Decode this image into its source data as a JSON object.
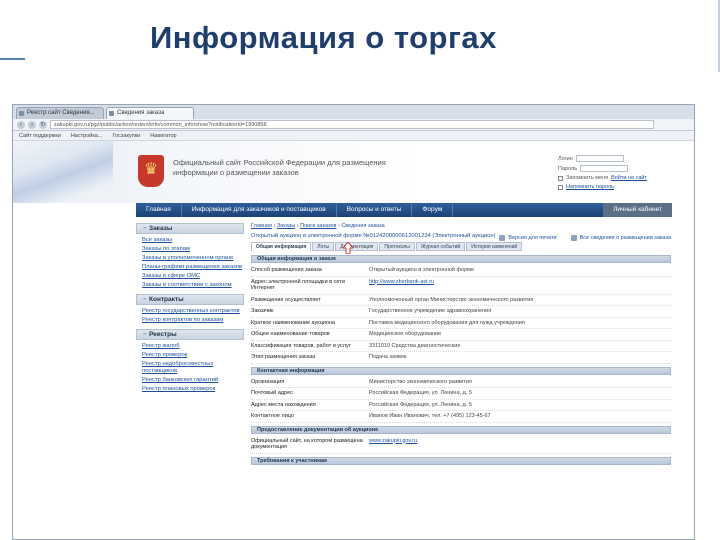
{
  "slide": {
    "title": "Информация о торгах"
  },
  "browser": {
    "tabs": [
      "Реестр сайт Сведения...",
      "Сведения заказа"
    ],
    "url": "zakupki.gov.ru/pgz/public/action/orders/info/common_info/show?notificationId=1990858",
    "bookmarks": [
      "Сайт поддержки",
      "Настройка...",
      "Госзакупки",
      "Навигатор"
    ]
  },
  "header": {
    "site_name": "Официальный сайт Российской Федерации для размещения информации о размещении заказов",
    "login": {
      "login_label": "Логин",
      "password_label": "Пароль",
      "remember": "Запомнить меня",
      "forgot": "Напомнить пароль",
      "enter": "Войти на сайт"
    }
  },
  "topnav": {
    "items": [
      "Главная",
      "Информация для заказчиков и поставщиков",
      "Вопросы и ответы",
      "Форум"
    ],
    "right": "Личный кабинет"
  },
  "sidebar": {
    "sections": [
      {
        "title": "Заказы",
        "links": [
          "Все заказы",
          "Заказы по этапам",
          "Заказы в уполномоченном органе",
          "Планы-графики размещения заказов",
          "Заказы в сфере ОМС",
          "Заказы в соответствии с законом"
        ]
      },
      {
        "title": "Контракты",
        "links": [
          "Реестр государственных контрактов",
          "Реестр контрактов по заказам"
        ]
      },
      {
        "title": "Реестры",
        "links": [
          "Реестр жалоб",
          "Реестр проверок",
          "Реестр недобросовестных поставщиков",
          "Реестр банковских гарантий",
          "Реестр плановых проверок"
        ]
      }
    ]
  },
  "main": {
    "breadcrumb": [
      "Главная",
      "Заказы",
      "Поиск заказов",
      "Сведения заказа"
    ],
    "actions": [
      "Версия для печати",
      "Все сведения о размещении заказа"
    ],
    "procedure_title": "Открытый аукцион в электронной форме №0124200000612001234 (Электронный аукцион)",
    "tabs": [
      "Общая информация",
      "Лоты",
      "Документация",
      "Протоколы",
      "Журнал событий",
      "История изменений"
    ],
    "sections": [
      {
        "title": "Общая информация о заказе",
        "rows": [
          {
            "label": "Способ размещения заказа",
            "value": "Открытый аукцион в электронной форме",
            "link": false
          },
          {
            "label": "Адрес электронной площадки в сети Интернет",
            "value": "http://www.sberbank-ast.ru",
            "link": true
          },
          {
            "label": "Размещение осуществляет",
            "value": "Уполномоченный орган Министерство экономического развития",
            "link": false
          },
          {
            "label": "Заказчик",
            "value": "Государственное учреждение здравоохранения",
            "link": false
          },
          {
            "label": "Краткое наименование аукциона",
            "value": "Поставка медицинского оборудования для нужд учреждения",
            "link": false
          },
          {
            "label": "Общее наименование товаров",
            "value": "Медицинское оборудование",
            "link": false
          },
          {
            "label": "Классификация товаров, работ и услуг",
            "value": "3311010 Средства диагностические",
            "link": false
          },
          {
            "label": "Этап размещения заказа",
            "value": "Подача заявок",
            "link": false
          }
        ]
      },
      {
        "title": "Контактная информация",
        "rows": [
          {
            "label": "Организация",
            "value": "Министерство экономического развития",
            "link": false
          },
          {
            "label": "Почтовый адрес",
            "value": "Российская Федерация, ул. Ленина, д. 5",
            "link": false
          },
          {
            "label": "Адрес места нахождения",
            "value": "Российская Федерация, ул. Ленина, д. 5",
            "link": false
          },
          {
            "label": "Контактное лицо",
            "value": "Иванов Иван Иванович, тел. +7 (495) 123-45-67",
            "link": false
          }
        ]
      },
      {
        "title": "Предоставление документации об аукционе",
        "rows": [
          {
            "label": "Официальный сайт, на котором размещена документация",
            "value": "www.zakupki.gov.ru",
            "link": true
          }
        ]
      },
      {
        "title": "Требования к участникам",
        "rows": []
      }
    ]
  }
}
